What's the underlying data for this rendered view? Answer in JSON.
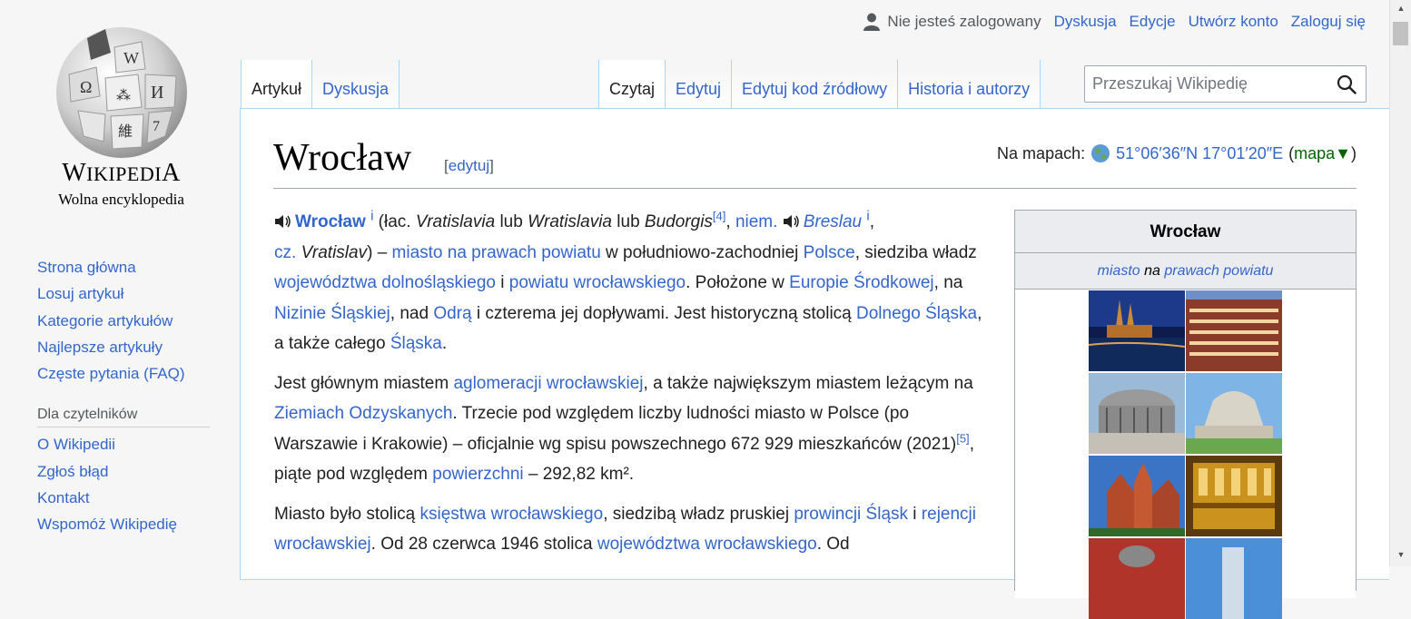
{
  "logo": {
    "wordmark": "Wikipedia",
    "tagline": "Wolna encyklopedia"
  },
  "personal": {
    "anon_label": "Nie jesteś zalogowany",
    "links": [
      "Dyskusja",
      "Edycje",
      "Utwórz konto",
      "Zaloguj się"
    ]
  },
  "sidebar": {
    "main": [
      "Strona główna",
      "Losuj artykuł",
      "Kategorie artykułów",
      "Najlepsze artykuły",
      "Częste pytania (FAQ)"
    ],
    "readers_heading": "Dla czytelników",
    "readers": [
      "O Wikipedii",
      "Zgłoś błąd",
      "Kontakt",
      "Wspomóż Wikipedię"
    ]
  },
  "tabs": {
    "left": [
      "Artykuł",
      "Dyskusja"
    ],
    "right": [
      "Czytaj",
      "Edytuj",
      "Edytuj kod źródłowy",
      "Historia i autorzy"
    ]
  },
  "search": {
    "placeholder": "Przeszukaj Wikipedię"
  },
  "page": {
    "title": "Wrocław",
    "edit_label": "[edytuj]",
    "coords_label": "Na mapach:",
    "coords": "51°06′36″N 17°01′20″E",
    "map_link": "mapa",
    "map_arrow": "▼"
  },
  "article": {
    "p1": {
      "name": "Wrocław",
      "i1": "i",
      "t1": " (łac. ",
      "lat1": "Vratislavia",
      "t2": " lub ",
      "lat2": "Wratislavia",
      "t3": " lub ",
      "lat3": "Budorgis",
      "ref4": "[4]",
      "t4": ", ",
      "niem": "niem.",
      "breslau": "Breslau",
      "i2": "i",
      "t5": ",",
      "cz": "cz.",
      "vratislav": "Vratislav",
      "t6": ") – ",
      "miasto": "miasto na prawach powiatu",
      "t7": " w południowo-zachodniej ",
      "polsce": "Polsce",
      "t8": ", siedziba władz ",
      "woj": "województwa dolnośląskiego",
      "t9": " i ",
      "pow": "powiatu wrocławskiego",
      "t10": ". Położone w ",
      "europa": "Europie Środkowej",
      "t11": ", na ",
      "nizina": "Nizinie Śląskiej",
      "t12": ", nad ",
      "odra": "Odrą",
      "t13": " i czterema jej dopływami. Jest historyczną stolicą ",
      "dolny": "Dolnego Śląska",
      "t14": ", a także całego ",
      "slask": "Śląska",
      "t15": "."
    },
    "p2": {
      "t1": "Jest głównym miastem ",
      "aglo": "aglomeracji wrocławskiej",
      "t2": ", a także największym miastem leżącym na ",
      "ziemie": "Ziemiach Odzyskanych",
      "t3": ". Trzecie pod względem liczby ludności miasto w Polsce (po Warszawie i Krakowie) – oficjalnie wg spisu powszechnego 672 929 mieszkańców (2021)",
      "ref5": "[5]",
      "t4": ", piąte pod względem ",
      "pow": "powierzchni",
      "t5": " – 292,82 km²."
    },
    "p3": {
      "t1": "Miasto było stolicą ",
      "ksiestwo": "księstwa wrocławskiego",
      "t2": ", siedzibą władz pruskiej ",
      "prow": "prowincji Śląsk",
      "t3": " i ",
      "rej": "rejencji wrocławskiej",
      "t4": ". Od 28 czerwca 1946 stolica ",
      "woj": "województwa wrocławskiego",
      "t5": ". Od"
    }
  },
  "infobox": {
    "title": "Wrocław",
    "sub_link1": "miasto",
    "sub_mid": " na ",
    "sub_link2": "prawach powiatu"
  },
  "colors": {
    "link": "#3366cc",
    "text": "#202122",
    "border": "#a7d7f9"
  }
}
